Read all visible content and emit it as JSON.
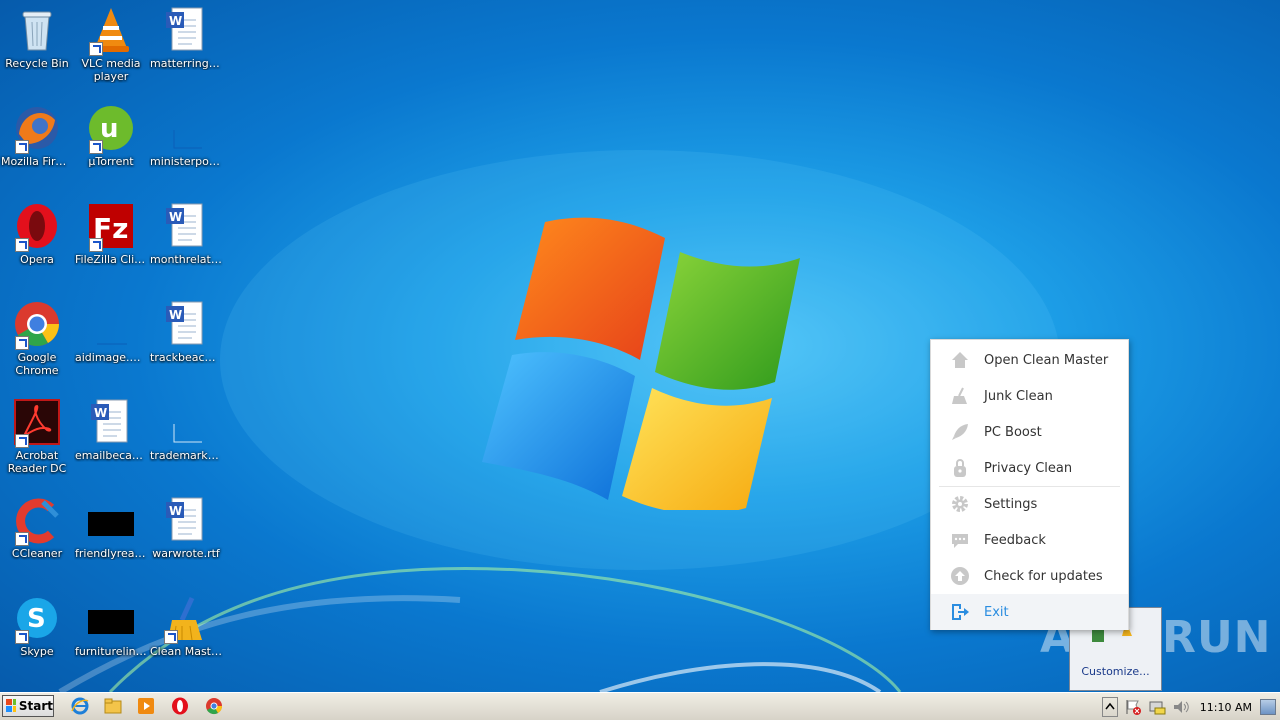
{
  "desktop": {
    "icons": [
      {
        "label": "Recycle Bin",
        "icon": "recycle-bin-icon"
      },
      {
        "label": "VLC media player",
        "icon": "vlc-icon"
      },
      {
        "label": "matterring.rtf",
        "icon": "word-document-icon"
      },
      {
        "label": "Mozilla Firefox",
        "icon": "firefox-icon"
      },
      {
        "label": "µTorrent",
        "icon": "utorrent-icon"
      },
      {
        "label": "ministerpolit...",
        "icon": "blank-file-icon"
      },
      {
        "label": "Opera",
        "icon": "opera-icon"
      },
      {
        "label": "FileZilla Client",
        "icon": "filezilla-icon"
      },
      {
        "label": "monthrelati...",
        "icon": "word-document-icon"
      },
      {
        "label": "Google Chrome",
        "icon": "chrome-icon"
      },
      {
        "label": "aidimage.png",
        "icon": "image-file-icon"
      },
      {
        "label": "trackbeach.rtf",
        "icon": "word-document-icon"
      },
      {
        "label": "Acrobat Reader DC",
        "icon": "acrobat-icon"
      },
      {
        "label": "emailbecau...",
        "icon": "word-document-icon"
      },
      {
        "label": "trademarkss...",
        "icon": "blank-file-icon"
      },
      {
        "label": "CCleaner",
        "icon": "ccleaner-icon"
      },
      {
        "label": "friendlyread...",
        "icon": "black-thumbnail-icon"
      },
      {
        "label": "warwrote.rtf",
        "icon": "word-document-icon"
      },
      {
        "label": "Skype",
        "icon": "skype-icon"
      },
      {
        "label": "furnitureline...",
        "icon": "black-thumbnail-icon"
      },
      {
        "label": "Clean Master",
        "icon": "clean-master-icon"
      }
    ]
  },
  "context_menu": {
    "items": [
      {
        "label": "Open Clean Master",
        "icon": "home-icon"
      },
      {
        "label": "Junk Clean",
        "icon": "broom-icon"
      },
      {
        "label": "PC Boost",
        "icon": "rocket-icon"
      },
      {
        "label": "Privacy Clean",
        "icon": "lock-icon"
      },
      {
        "label": "Settings",
        "icon": "gear-icon"
      },
      {
        "label": "Feedback",
        "icon": "chat-icon"
      },
      {
        "label": "Check for updates",
        "icon": "arrow-up-icon"
      },
      {
        "label": "Exit",
        "icon": "exit-icon"
      }
    ]
  },
  "tray_popup": {
    "customize_label": "Customize..."
  },
  "watermark": {
    "text": "ANY RUN"
  },
  "taskbar": {
    "start_label": "Start",
    "clock": "11:10 AM"
  },
  "colors": {
    "desktop_blue": "#0a78cf",
    "menu_icon_gray": "#c8c8c8",
    "menu_accent": "#2b8de0"
  }
}
